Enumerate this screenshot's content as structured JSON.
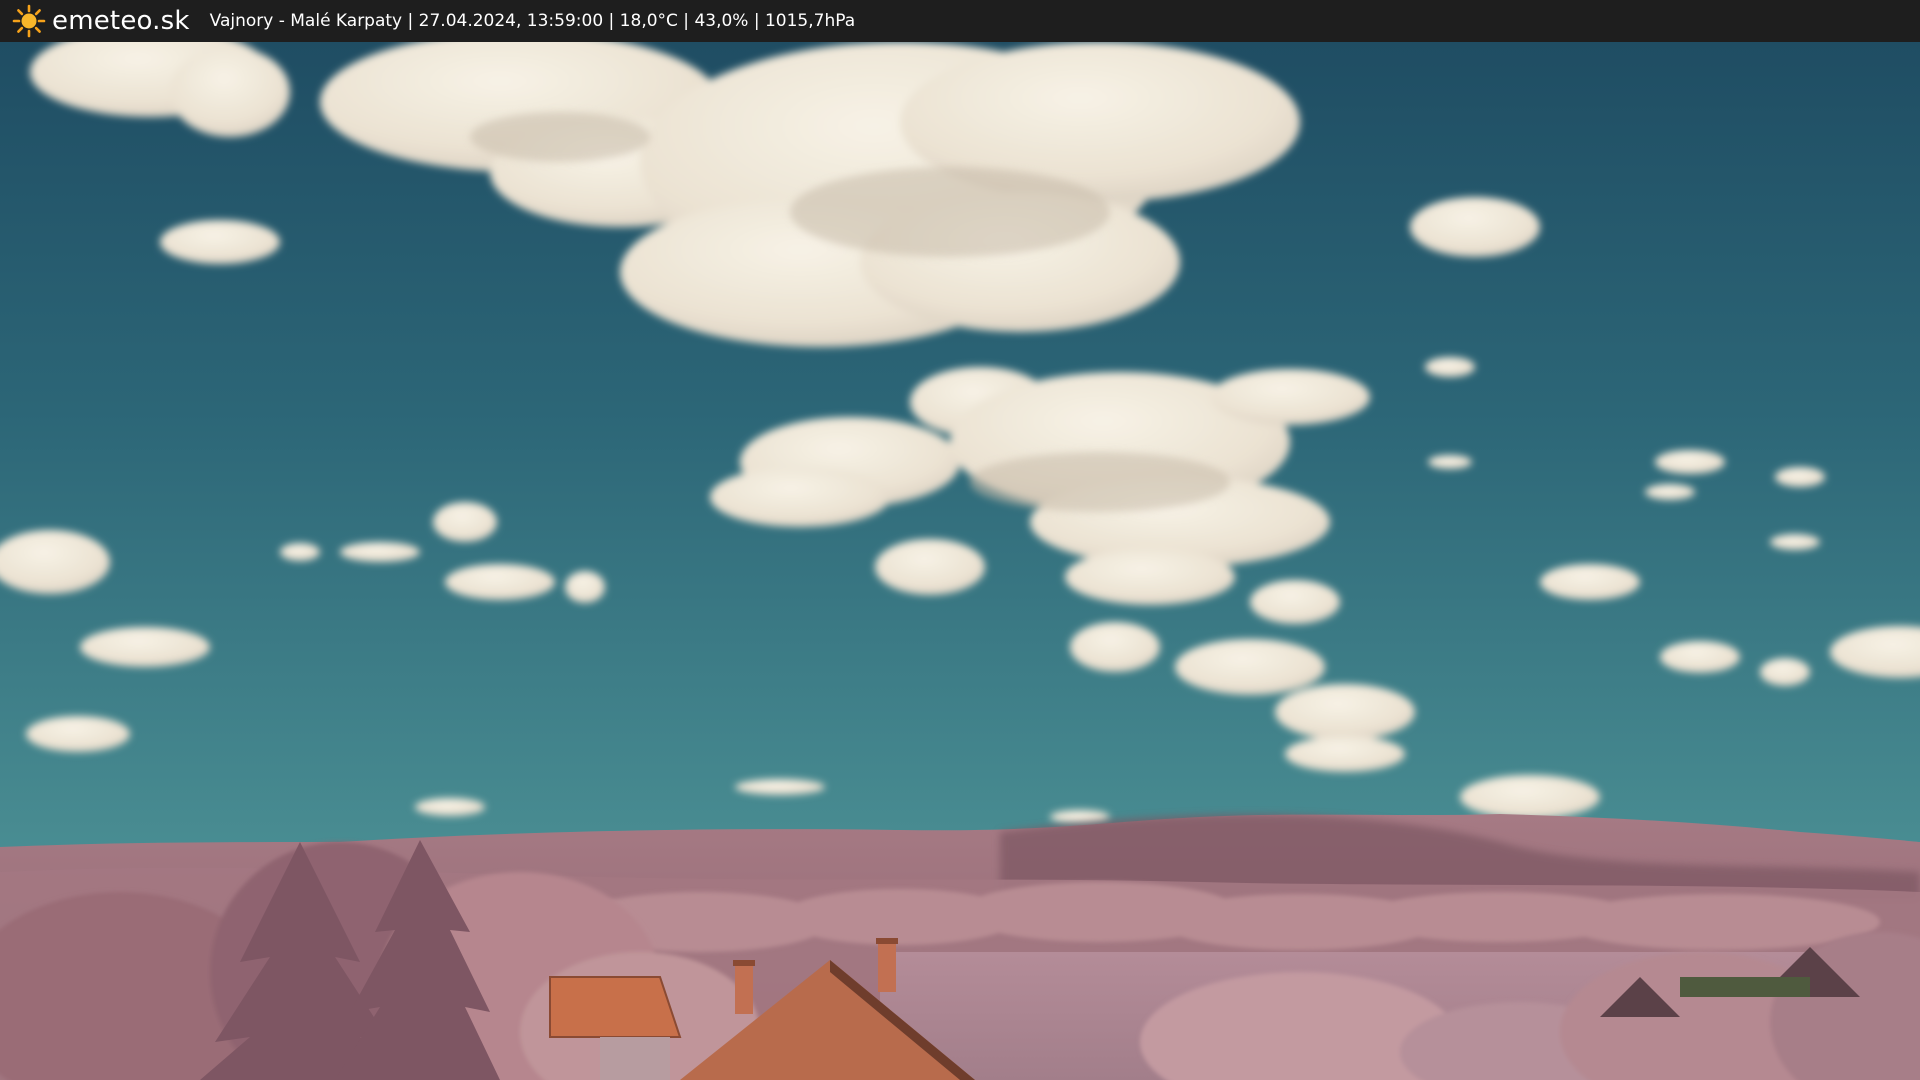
{
  "header": {
    "brand": "emeteo.sk",
    "caption": "Vajnory - Malé Karpaty | 27.04.2024, 13:59:00 | 18,0°C | 43,0% | 1015,7hPa",
    "icon": "sun-icon"
  },
  "colors": {
    "sky_top": "#1f4f64",
    "sky_bottom": "#3f8490",
    "cloud": "#efe8da",
    "hills": "#9e7580",
    "foliage": "#b98a8e",
    "roof": "#c8704a",
    "bar": "#1e1e1e"
  }
}
